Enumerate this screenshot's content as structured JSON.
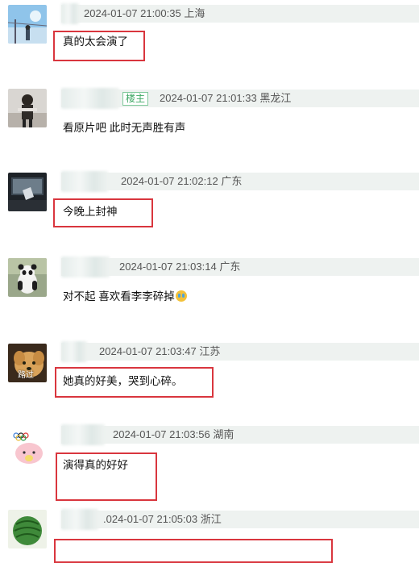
{
  "comments": [
    {
      "time": "2024-01-07 21:00:35 上海",
      "text": "真的太会演了"
    },
    {
      "badge": "楼主",
      "time": "2024-01-07 21:01:33 黑龙江",
      "text": "看原片吧 此时无声胜有声"
    },
    {
      "time": "2024-01-07 21:02:12 广东",
      "text": "今晚上封神"
    },
    {
      "time": "2024-01-07 21:03:14 广东",
      "text": "对不起 喜欢看李李碎掉"
    },
    {
      "time": "2024-01-07 21:03:47 江苏",
      "text": "她真的好美，哭到心碎。",
      "avatar_label": "路过"
    },
    {
      "time": "2024-01-07 21:03:56 湖南",
      "text": "演得真的好好"
    },
    {
      "time": ".024-01-07 21:05:03 浙江",
      "text": ""
    }
  ],
  "icons": {
    "crying_emoji": "crying-face-emoji"
  },
  "colors": {
    "highlight_box": "#d9363e",
    "meta_bar": "#eef2f0",
    "badge": "#3fa865"
  }
}
